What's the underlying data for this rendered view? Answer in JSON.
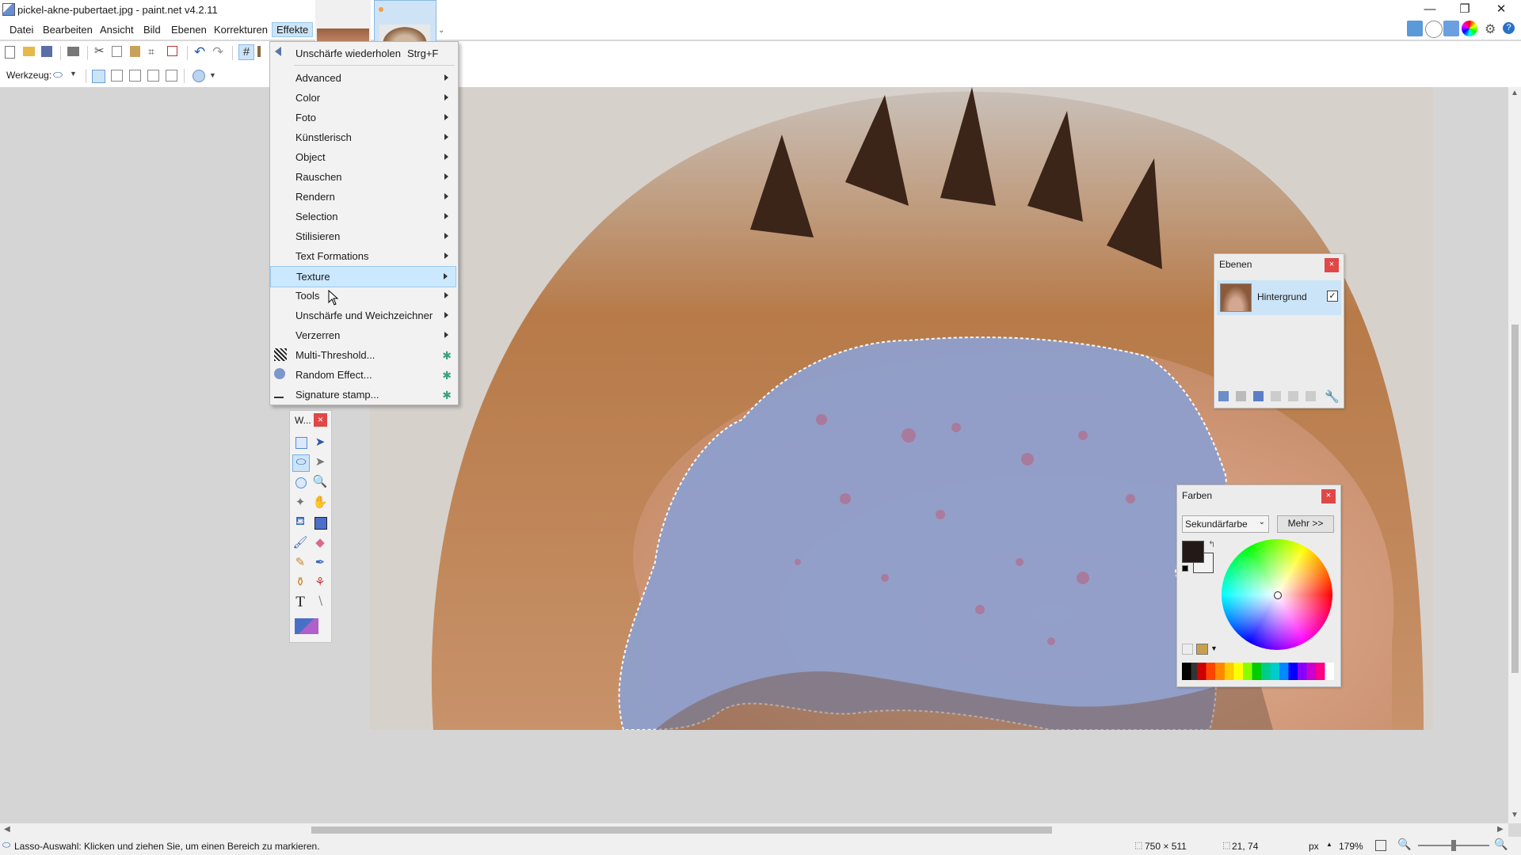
{
  "window": {
    "title": "pickel-akne-pubertaet.jpg - paint.net v4.2.11",
    "minimize": "—",
    "maximize": "❐",
    "close": "✕"
  },
  "menubar": [
    "Datei",
    "Bearbeiten",
    "Ansicht",
    "Bild",
    "Ebenen",
    "Korrekturen",
    "Effekte"
  ],
  "toolbar2": {
    "tool_label": "Werkzeug:"
  },
  "effects_menu": {
    "repeat": {
      "label": "Unschärfe wiederholen",
      "shortcut": "Strg+F"
    },
    "submenus": [
      "Advanced",
      "Color",
      "Foto",
      "Künstlerisch",
      "Object",
      "Rauschen",
      "Rendern",
      "Selection",
      "Stilisieren",
      "Text Formations",
      "Texture",
      "Tools",
      "Unschärfe und Weichzeichner",
      "Verzerren"
    ],
    "hovered": "Texture",
    "plugins": [
      "Multi-Threshold...",
      "Random Effect...",
      "Signature stamp..."
    ]
  },
  "tools_window": {
    "title": "W...",
    "close": "×"
  },
  "layers_panel": {
    "title": "Ebenen",
    "close": "×",
    "layer_name": "Hintergrund",
    "layer_visible": true
  },
  "colors_panel": {
    "title": "Farben",
    "close": "×",
    "dropdown_value": "Sekundärfarbe",
    "more_button": "Mehr >>",
    "primary_color": "#231a17",
    "secondary_color": "#f2f2f2"
  },
  "status": {
    "hint": "Lasso-Auswahl: Klicken und ziehen Sie, um einen Bereich zu markieren.",
    "image_size": "750 × 511",
    "cursor_pos": "21, 74",
    "unit": "px",
    "zoom": "179%"
  },
  "colors": {
    "accent_blue": "#cce4f7",
    "close_red": "#e04747",
    "selection_tint": "#8f9fcc"
  }
}
